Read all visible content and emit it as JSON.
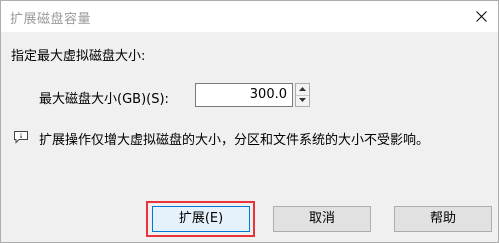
{
  "dialog": {
    "title": "扩展磁盘容量"
  },
  "main": {
    "heading": "指定最大虚拟磁盘大小:",
    "size_label": "最大磁盘大小(GB)(S):",
    "size_value": "300.0",
    "info_icon": "info-comment-icon",
    "info_text": "扩展操作仅增大虚拟磁盘的大小，分区和文件系统的大小不受影响。"
  },
  "buttons": {
    "expand_label": "扩展(E)",
    "cancel_label": "取消",
    "help_label": "帮助"
  },
  "colors": {
    "highlight": "#e8343a",
    "focus_border": "#0078d7"
  }
}
